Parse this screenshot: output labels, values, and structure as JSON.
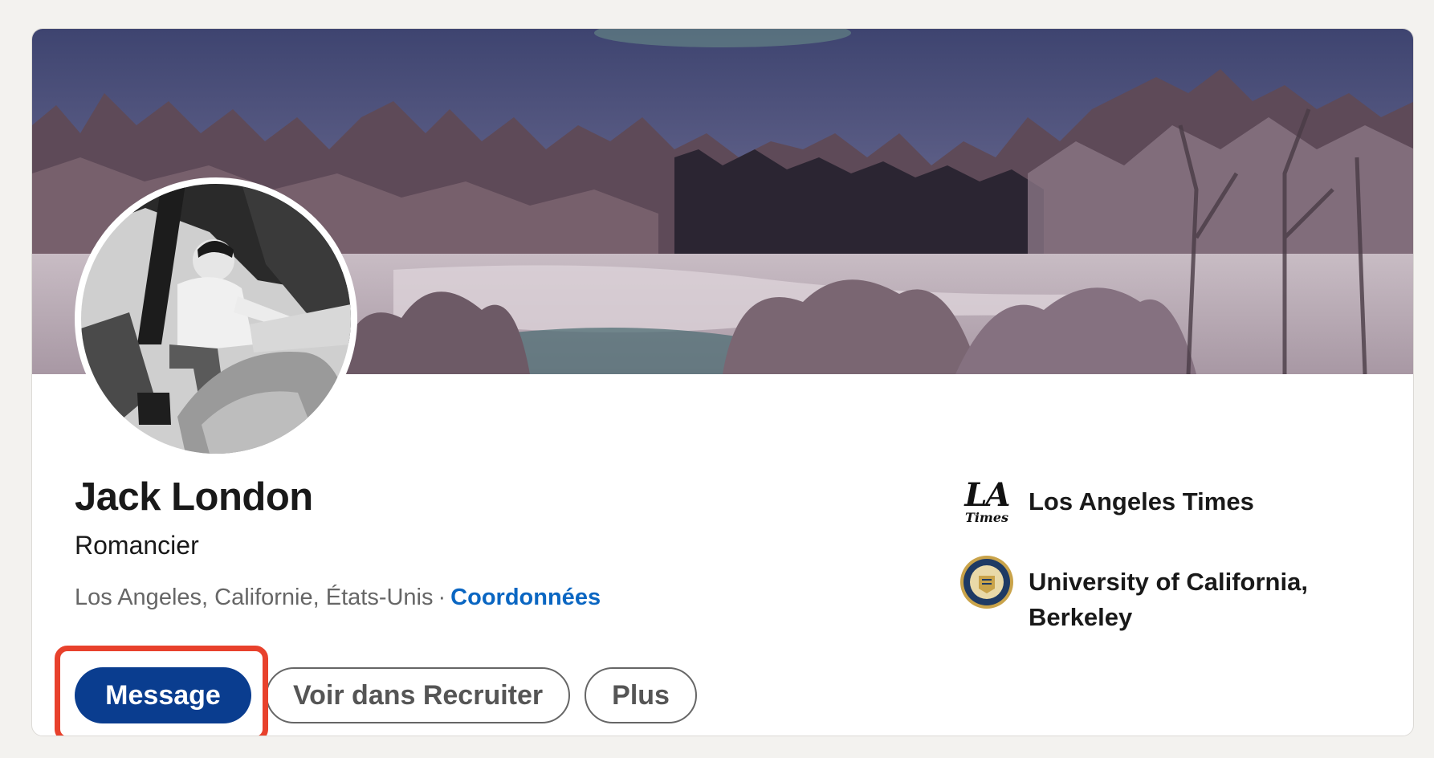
{
  "profile": {
    "name": "Jack London",
    "headline": "Romancier",
    "location": "Los Angeles, Californie, États-Unis",
    "separator": "·",
    "contact_link": "Coordonnées"
  },
  "actions": {
    "message_label": "Message",
    "recruiter_label": "Voir dans Recruiter",
    "more_label": "Plus"
  },
  "organizations": [
    {
      "name": "Los Angeles Times",
      "logo": "la-times-logo",
      "logo_text_top": "LA",
      "logo_text_bottom": "Times"
    },
    {
      "name": "University of California, Berkeley",
      "logo": "uc-berkeley-seal-logo"
    }
  ],
  "colors": {
    "primary_button": "#0a3d8f",
    "link": "#0a66c2",
    "highlight": "#e8412c"
  }
}
